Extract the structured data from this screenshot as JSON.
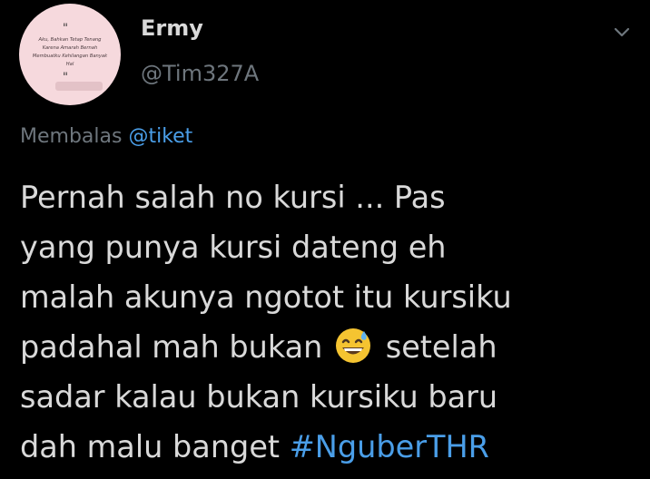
{
  "author": {
    "name": "Ermy",
    "handle": "@Tim327A",
    "avatar": {
      "open_quote": "\"",
      "quote_text": "Aku, Bahkan Tetap Tenang\nKarena Amarah Bernah\nMembuatku Kehilangan Banyak\nHal",
      "close_quote": "\""
    }
  },
  "reply": {
    "prefix": "Membalas",
    "mention": "@tiket"
  },
  "tweet": {
    "lines": [
      "Pernah salah no kursi ... Pas",
      "yang punya kursi dateng eh",
      "malah akunya ngotot itu kursiku",
      "padahal mah bukan",
      "setelah",
      "sadar kalau bukan kursiku baru",
      "dah malu banget"
    ],
    "hashtag": "#NguberTHR",
    "emoji": "grinning-face-with-sweat-icon"
  },
  "colors": {
    "background": "#000000",
    "text": "#d9d9d9",
    "muted": "#6e767d",
    "link": "#4a9ee8"
  }
}
